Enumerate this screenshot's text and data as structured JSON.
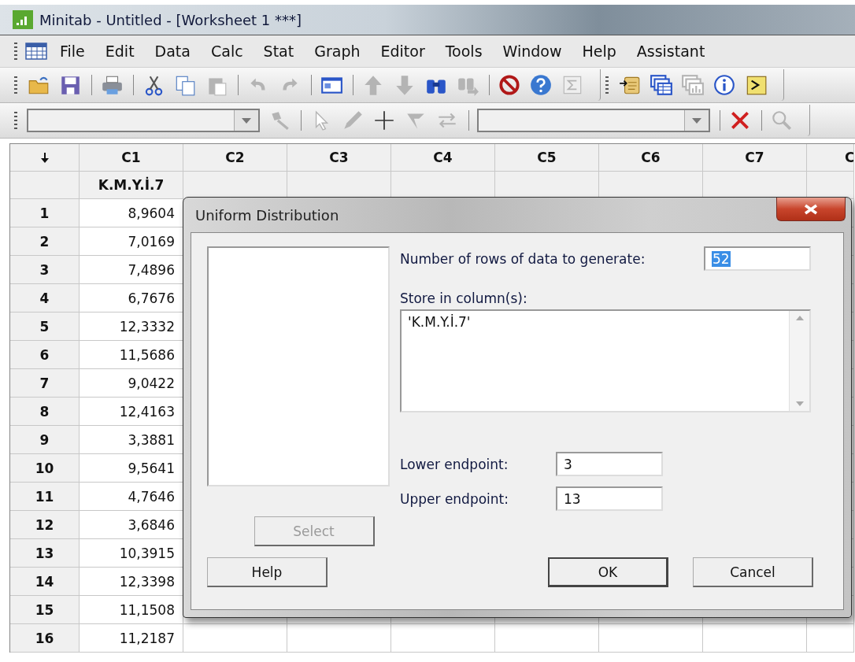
{
  "window": {
    "title": "Minitab - Untitled - [Worksheet 1 ***]"
  },
  "menu": [
    {
      "label": "File"
    },
    {
      "label": "Edit"
    },
    {
      "label": "Data"
    },
    {
      "label": "Calc"
    },
    {
      "label": "Stat"
    },
    {
      "label": "Graph"
    },
    {
      "label": "Editor"
    },
    {
      "label": "Tools"
    },
    {
      "label": "Window"
    },
    {
      "label": "Help"
    },
    {
      "label": "Assistant"
    }
  ],
  "toolbar_rows": [
    {
      "groups": [
        {
          "items": [
            {
              "kind": "open",
              "disabled": false
            },
            {
              "kind": "save",
              "disabled": false
            },
            {
              "kind": "separator"
            },
            {
              "kind": "print",
              "disabled": false
            },
            {
              "kind": "separator"
            },
            {
              "kind": "cut",
              "disabled": false
            },
            {
              "kind": "copy",
              "disabled": false
            },
            {
              "kind": "paste",
              "disabled": true
            },
            {
              "kind": "separator"
            },
            {
              "kind": "undo",
              "disabled": true
            },
            {
              "kind": "redo",
              "disabled": true
            },
            {
              "kind": "separator"
            },
            {
              "kind": "window",
              "disabled": false
            },
            {
              "kind": "separator"
            },
            {
              "kind": "up",
              "disabled": true
            },
            {
              "kind": "down",
              "disabled": true
            },
            {
              "kind": "find",
              "disabled": false
            },
            {
              "kind": "findnext",
              "disabled": true
            },
            {
              "kind": "separator"
            },
            {
              "kind": "stop",
              "disabled": false
            },
            {
              "kind": "help",
              "disabled": false
            },
            {
              "kind": "sigma",
              "disabled": true
            }
          ]
        },
        {
          "items": [
            {
              "kind": "script",
              "disabled": false
            },
            {
              "kind": "worksheets",
              "disabled": false
            },
            {
              "kind": "graphs",
              "disabled": true
            },
            {
              "kind": "info",
              "disabled": false
            },
            {
              "kind": "command",
              "disabled": false
            }
          ]
        }
      ]
    },
    {
      "groups": [
        {
          "items": [
            {
              "kind": "dropdown"
            },
            {
              "kind": "brush",
              "disabled": true
            },
            {
              "kind": "separator"
            },
            {
              "kind": "pointer",
              "disabled": true
            },
            {
              "kind": "pencil",
              "disabled": true
            },
            {
              "kind": "plus",
              "disabled": false
            },
            {
              "kind": "flag",
              "disabled": true
            },
            {
              "kind": "swap",
              "disabled": true
            },
            {
              "kind": "separator"
            },
            {
              "kind": "dropdown"
            },
            {
              "kind": "separator"
            },
            {
              "kind": "delete",
              "disabled": false
            },
            {
              "kind": "separator"
            },
            {
              "kind": "zoom",
              "disabled": true
            }
          ]
        }
      ]
    }
  ],
  "worksheet": {
    "columns": [
      "C1",
      "C2",
      "C3",
      "C4",
      "C5",
      "C6",
      "C7",
      "C"
    ],
    "column_names": [
      "K.M.Y.İ.7"
    ],
    "rows": [
      {
        "number": "1",
        "values": [
          "8,9604"
        ]
      },
      {
        "number": "2",
        "values": [
          "7,0169"
        ]
      },
      {
        "number": "3",
        "values": [
          "7,4896"
        ]
      },
      {
        "number": "4",
        "values": [
          "6,7676"
        ]
      },
      {
        "number": "5",
        "values": [
          "12,3332"
        ]
      },
      {
        "number": "6",
        "values": [
          "11,5686"
        ]
      },
      {
        "number": "7",
        "values": [
          "9,0422"
        ]
      },
      {
        "number": "8",
        "values": [
          "12,4163"
        ]
      },
      {
        "number": "9",
        "values": [
          "3,3881"
        ]
      },
      {
        "number": "10",
        "values": [
          "9,5641"
        ]
      },
      {
        "number": "11",
        "values": [
          "4,7646"
        ]
      },
      {
        "number": "12",
        "values": [
          "3,6846"
        ]
      },
      {
        "number": "13",
        "values": [
          "10,3915"
        ]
      },
      {
        "number": "14",
        "values": [
          "12,3398"
        ]
      },
      {
        "number": "15",
        "values": [
          "11,1508"
        ]
      },
      {
        "number": "16",
        "values": [
          "11,2187"
        ]
      }
    ]
  },
  "dialog": {
    "title": "Uniform Distribution",
    "select_button": {
      "label": "Select",
      "disabled": true
    },
    "rows_field": {
      "label": "Number of rows of data to generate:",
      "value": "52",
      "selected": true
    },
    "store_field": {
      "label": "Store in column(s):",
      "value": "'K.M.Y.İ.7'"
    },
    "endpoints": [
      {
        "label": "Lower endpoint:",
        "value": "3"
      },
      {
        "label": "Upper endpoint:",
        "value": "13"
      }
    ],
    "help_button": {
      "label": "Help"
    },
    "buttons": [
      {
        "label": "OK",
        "default": true
      },
      {
        "label": "Cancel",
        "default": false
      }
    ]
  }
}
